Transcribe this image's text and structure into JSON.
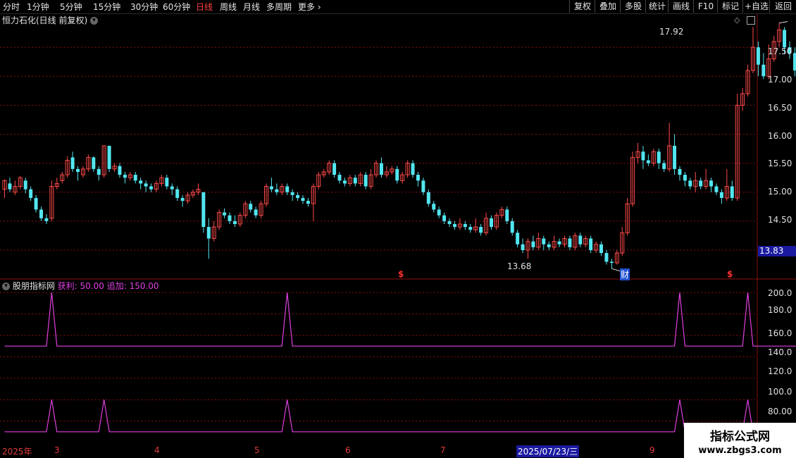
{
  "periods": [
    "分时",
    "1分钟",
    "5分钟",
    "15分钟",
    "30分钟",
    "60分钟",
    "日线",
    "周线",
    "月线",
    "多周期",
    "更多"
  ],
  "active_period": "日线",
  "tools": [
    "复权",
    "叠加",
    "多股",
    "统计",
    "画线",
    "F10",
    "标记",
    "+自选",
    "返回"
  ],
  "title": "恒力石化(日线 前复权)",
  "price_axis": [
    "17.50",
    "17.00",
    "16.50",
    "16.00",
    "15.50",
    "15.00",
    "14.50"
  ],
  "current_price": "13.83",
  "high_label": "17.92",
  "low_label": "13.68",
  "markers": {
    "s1": "$",
    "cai": "财",
    "s2": "$"
  },
  "indicator": {
    "name": "股朋指标网",
    "param1": "获利: 50.00",
    "param2": "追加: 150.00"
  },
  "ind_axis": [
    "200.0",
    "180.0",
    "160.0",
    "140.0",
    "120.0",
    "100.0",
    "80.00"
  ],
  "dates": [
    "2025年",
    "3",
    "4",
    "5",
    "6",
    "7",
    "2025/07/23/三",
    "9"
  ],
  "watermark": {
    "line1": "指标公式网",
    "line2": "www.zbgs3.com"
  },
  "colors": {
    "up": "#ff4a4a",
    "down": "#52e6f0",
    "line": "#e040e0",
    "grid": "#8a1010",
    "date": "#e03c3c"
  },
  "chart_data": {
    "type": "candlestick",
    "ylim": [
      13.55,
      18.0
    ],
    "candles": [
      [
        15.05,
        15.2,
        15.22,
        14.9
      ],
      [
        15.15,
        15.05,
        15.25,
        15.0
      ],
      [
        15.0,
        15.1,
        15.2,
        14.95
      ],
      [
        15.1,
        15.25,
        15.28,
        15.05
      ],
      [
        15.2,
        15.05,
        15.25,
        14.98
      ],
      [
        15.05,
        14.9,
        15.1,
        14.85
      ],
      [
        14.9,
        14.7,
        14.95,
        14.65
      ],
      [
        14.7,
        14.55,
        14.75,
        14.5
      ],
      [
        14.55,
        14.5,
        14.62,
        14.45
      ],
      [
        14.55,
        15.1,
        15.2,
        14.5
      ],
      [
        15.1,
        15.15,
        15.25,
        15.05
      ],
      [
        15.2,
        15.3,
        15.35,
        15.15
      ],
      [
        15.3,
        15.55,
        15.62,
        15.25
      ],
      [
        15.6,
        15.4,
        15.7,
        15.35
      ],
      [
        15.4,
        15.35,
        15.45,
        15.2
      ],
      [
        15.3,
        15.4,
        15.45,
        15.25
      ],
      [
        15.4,
        15.6,
        15.65,
        15.35
      ],
      [
        15.6,
        15.4,
        15.62,
        15.35
      ],
      [
        15.4,
        15.3,
        15.45,
        15.2
      ],
      [
        15.3,
        15.8,
        15.8,
        15.25
      ],
      [
        15.8,
        15.4,
        15.8,
        15.35
      ],
      [
        15.4,
        15.45,
        15.5,
        15.35
      ],
      [
        15.45,
        15.3,
        15.5,
        15.25
      ],
      [
        15.3,
        15.25,
        15.35,
        15.15
      ],
      [
        15.25,
        15.3,
        15.35,
        15.2
      ],
      [
        15.3,
        15.2,
        15.35,
        15.15
      ],
      [
        15.2,
        15.15,
        15.25,
        15.05
      ],
      [
        15.15,
        15.1,
        15.2,
        15.0
      ],
      [
        15.1,
        15.05,
        15.15,
        15.0
      ],
      [
        15.05,
        15.15,
        15.2,
        15.0
      ],
      [
        15.15,
        15.25,
        15.3,
        15.1
      ],
      [
        15.25,
        15.1,
        15.3,
        15.05
      ],
      [
        15.1,
        15.05,
        15.15,
        14.95
      ],
      [
        15.05,
        14.9,
        15.1,
        14.85
      ],
      [
        14.9,
        14.85,
        14.95,
        14.75
      ],
      [
        14.85,
        14.95,
        15.0,
        14.8
      ],
      [
        14.95,
        15.0,
        15.05,
        14.9
      ],
      [
        15.0,
        15.05,
        15.15,
        14.95
      ],
      [
        15.0,
        14.4,
        15.0,
        14.3
      ],
      [
        14.4,
        14.2,
        14.55,
        13.85
      ],
      [
        14.2,
        14.4,
        14.5,
        14.15
      ],
      [
        14.4,
        14.65,
        14.7,
        14.35
      ],
      [
        14.65,
        14.6,
        14.72,
        14.55
      ],
      [
        14.6,
        14.5,
        14.65,
        14.45
      ],
      [
        14.5,
        14.45,
        14.6,
        14.4
      ],
      [
        14.45,
        14.6,
        14.65,
        14.4
      ],
      [
        14.6,
        14.8,
        14.85,
        14.55
      ],
      [
        14.8,
        14.7,
        14.85,
        14.65
      ],
      [
        14.7,
        14.6,
        14.75,
        14.55
      ],
      [
        14.6,
        14.8,
        14.85,
        14.55
      ],
      [
        14.8,
        15.1,
        15.15,
        14.75
      ],
      [
        15.1,
        15.05,
        15.25,
        15.0
      ],
      [
        15.05,
        15.0,
        15.15,
        14.95
      ],
      [
        15.0,
        15.1,
        15.15,
        14.95
      ],
      [
        15.1,
        15.0,
        15.15,
        14.95
      ],
      [
        15.0,
        14.95,
        15.05,
        14.85
      ],
      [
        14.95,
        14.9,
        15.0,
        14.85
      ],
      [
        14.9,
        14.85,
        14.95,
        14.8
      ],
      [
        14.85,
        14.8,
        14.9,
        14.75
      ],
      [
        14.8,
        15.1,
        15.15,
        14.5
      ],
      [
        15.1,
        15.3,
        15.35,
        15.05
      ],
      [
        15.3,
        15.35,
        15.4,
        15.25
      ],
      [
        15.35,
        15.5,
        15.55,
        15.3
      ],
      [
        15.5,
        15.3,
        15.55,
        15.25
      ],
      [
        15.3,
        15.2,
        15.35,
        15.15
      ],
      [
        15.2,
        15.15,
        15.25,
        15.1
      ],
      [
        15.15,
        15.25,
        15.3,
        15.1
      ],
      [
        15.25,
        15.15,
        15.3,
        15.1
      ],
      [
        15.15,
        15.3,
        15.35,
        15.1
      ],
      [
        15.3,
        15.1,
        15.35,
        15.05
      ],
      [
        15.1,
        15.3,
        15.4,
        15.05
      ],
      [
        15.3,
        15.5,
        15.55,
        15.25
      ],
      [
        15.5,
        15.3,
        15.6,
        15.25
      ],
      [
        15.3,
        15.35,
        15.45,
        15.25
      ],
      [
        15.35,
        15.4,
        15.45,
        15.3
      ],
      [
        15.4,
        15.2,
        15.45,
        15.15
      ],
      [
        15.2,
        15.3,
        15.35,
        15.15
      ],
      [
        15.3,
        15.5,
        15.55,
        15.25
      ],
      [
        15.5,
        15.3,
        15.55,
        15.25
      ],
      [
        15.3,
        15.2,
        15.35,
        15.1
      ],
      [
        15.2,
        15.0,
        15.25,
        14.95
      ],
      [
        15.0,
        14.8,
        15.05,
        14.75
      ],
      [
        14.8,
        14.7,
        14.85,
        14.65
      ],
      [
        14.7,
        14.6,
        14.75,
        14.55
      ],
      [
        14.6,
        14.5,
        14.65,
        14.45
      ],
      [
        14.5,
        14.45,
        14.55,
        14.4
      ],
      [
        14.45,
        14.4,
        14.5,
        14.35
      ],
      [
        14.4,
        14.45,
        14.55,
        14.35
      ],
      [
        14.45,
        14.4,
        14.5,
        14.35
      ],
      [
        14.4,
        14.35,
        14.45,
        14.3
      ],
      [
        14.35,
        14.4,
        14.55,
        14.3
      ],
      [
        14.4,
        14.3,
        14.45,
        14.25
      ],
      [
        14.3,
        14.55,
        14.65,
        14.25
      ],
      [
        14.55,
        14.4,
        14.6,
        14.35
      ],
      [
        14.4,
        14.6,
        14.65,
        14.35
      ],
      [
        14.6,
        14.7,
        14.75,
        14.55
      ],
      [
        14.7,
        14.5,
        14.75,
        14.45
      ],
      [
        14.5,
        14.3,
        14.55,
        14.25
      ],
      [
        14.3,
        14.1,
        14.35,
        14.05
      ],
      [
        14.1,
        14.0,
        14.2,
        13.95
      ],
      [
        14.0,
        14.15,
        14.2,
        13.85
      ],
      [
        14.15,
        14.05,
        14.25,
        14.0
      ],
      [
        14.05,
        14.2,
        14.3,
        14.0
      ],
      [
        14.2,
        14.1,
        14.25,
        14.0
      ],
      [
        14.1,
        14.05,
        14.15,
        14.0
      ],
      [
        14.05,
        14.15,
        14.25,
        14.0
      ],
      [
        14.15,
        14.1,
        14.2,
        14.05
      ],
      [
        14.1,
        14.2,
        14.25,
        14.05
      ],
      [
        14.2,
        14.05,
        14.25,
        14.0
      ],
      [
        14.05,
        14.25,
        14.3,
        14.0
      ],
      [
        14.25,
        14.1,
        14.3,
        14.05
      ],
      [
        14.1,
        14.2,
        14.25,
        14.05
      ],
      [
        14.2,
        14.0,
        14.25,
        13.95
      ],
      [
        14.0,
        14.1,
        14.15,
        13.95
      ],
      [
        14.1,
        13.95,
        14.15,
        13.9
      ],
      [
        13.95,
        13.8,
        14.0,
        13.75
      ],
      [
        13.8,
        13.78,
        13.85,
        13.68
      ],
      [
        13.78,
        13.95,
        14.0,
        13.75
      ],
      [
        13.95,
        14.3,
        14.4,
        13.9
      ],
      [
        14.3,
        14.8,
        14.9,
        14.25
      ],
      [
        14.8,
        15.6,
        15.7,
        14.75
      ],
      [
        15.6,
        15.7,
        15.85,
        15.5
      ],
      [
        15.7,
        15.55,
        15.8,
        15.4
      ],
      [
        15.55,
        15.5,
        15.65,
        15.45
      ],
      [
        15.5,
        15.7,
        15.75,
        15.45
      ],
      [
        15.7,
        15.5,
        15.75,
        15.4
      ],
      [
        15.5,
        15.4,
        15.55,
        15.35
      ],
      [
        15.4,
        15.8,
        16.2,
        15.35
      ],
      [
        15.8,
        15.4,
        16.0,
        15.3
      ],
      [
        15.4,
        15.3,
        15.45,
        15.2
      ],
      [
        15.3,
        15.2,
        15.35,
        15.1
      ],
      [
        15.2,
        15.1,
        15.25,
        15.05
      ],
      [
        15.1,
        15.2,
        15.35,
        15.0
      ],
      [
        15.2,
        15.1,
        15.25,
        15.05
      ],
      [
        15.1,
        15.2,
        15.4,
        15.05
      ],
      [
        15.2,
        15.1,
        15.25,
        15.0
      ],
      [
        15.1,
        15.0,
        15.15,
        14.95
      ],
      [
        15.0,
        14.9,
        15.05,
        14.8
      ],
      [
        14.9,
        15.1,
        15.4,
        14.85
      ],
      [
        15.1,
        14.9,
        15.2,
        14.85
      ],
      [
        14.9,
        16.5,
        16.7,
        14.85
      ],
      [
        16.5,
        16.7,
        16.8,
        16.4
      ],
      [
        16.7,
        17.1,
        17.2,
        16.65
      ],
      [
        17.1,
        17.5,
        17.85,
        17.05
      ],
      [
        17.5,
        17.2,
        17.6,
        17.0
      ],
      [
        17.2,
        17.0,
        17.4,
        16.95
      ],
      [
        17.0,
        17.3,
        17.55,
        16.95
      ],
      [
        17.3,
        17.6,
        17.7,
        17.25
      ],
      [
        17.6,
        17.8,
        17.92,
        17.5
      ],
      [
        17.8,
        17.5,
        17.85,
        17.4
      ],
      [
        17.5,
        17.4,
        17.6,
        17.3
      ],
      [
        17.4,
        17.1,
        17.5,
        17.0
      ],
      [
        17.1,
        16.9,
        17.2,
        16.8
      ],
      [
        16.9,
        17.1,
        17.2,
        16.85
      ],
      [
        17.1,
        17.6,
        17.65,
        17.0
      ],
      [
        17.6,
        17.2,
        17.65,
        17.1
      ],
      [
        17.2,
        17.0,
        17.3,
        16.95
      ],
      [
        17.0,
        16.8,
        17.1,
        16.7
      ],
      [
        16.8,
        16.6,
        16.9,
        16.5
      ],
      [
        16.6,
        16.8,
        16.9,
        16.55
      ],
      [
        16.8,
        16.7,
        16.9,
        16.55
      ],
      [
        16.7,
        16.5,
        16.8,
        16.45
      ],
      [
        16.5,
        16.6,
        16.7,
        16.4
      ],
      [
        16.6,
        16.4,
        16.7,
        16.35
      ],
      [
        16.4,
        16.3,
        16.5,
        16.2
      ],
      [
        16.3,
        16.2,
        16.4,
        16.1
      ],
      [
        16.2,
        16.35,
        16.45,
        16.1
      ],
      [
        16.35,
        16.95,
        17.35,
        16.15
      ]
    ],
    "indicator_line1": {
      "base": 150,
      "peak": 200,
      "peaks_at": [
        9,
        54,
        129,
        142
      ]
    },
    "indicator_line2": {
      "base": 70,
      "peak": 100,
      "peaks_at": [
        9,
        19,
        54,
        129,
        142
      ]
    }
  }
}
